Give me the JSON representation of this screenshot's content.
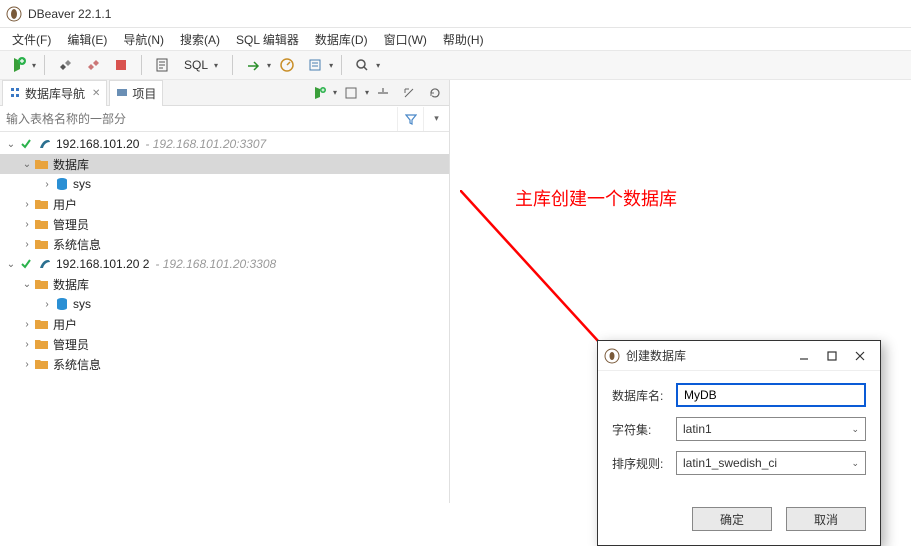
{
  "app": {
    "title": "DBeaver 22.1.1"
  },
  "menu": {
    "file": "文件(F)",
    "edit": "编辑(E)",
    "nav": "导航(N)",
    "search": "搜索(A)",
    "sqled": "SQL 编辑器",
    "db": "数据库(D)",
    "window": "窗口(W)",
    "help": "帮助(H)"
  },
  "toolbar": {
    "sql_label": "SQL"
  },
  "tabs": {
    "navigator": "数据库导航",
    "projects": "项目"
  },
  "filter": {
    "placeholder": "输入表格名称的一部分"
  },
  "tree": {
    "conn1": {
      "host": "192.168.101.20",
      "desc": "- 192.168.101.20:3307"
    },
    "conn2": {
      "host": "192.168.101.20 2",
      "desc": "- 192.168.101.20:3308"
    },
    "nodes": {
      "databases": "数据库",
      "sys": "sys",
      "users": "用户",
      "admins": "管理员",
      "sysinfo": "系统信息"
    }
  },
  "annotation": "主库创建一个数据库",
  "dialog": {
    "title": "创建数据库",
    "name_label": "数据库名:",
    "name_value": "MyDB",
    "charset_label": "字符集:",
    "charset_value": "latin1",
    "collation_label": "排序规则:",
    "collation_value": "latin1_swedish_ci",
    "ok": "确定",
    "cancel": "取消"
  }
}
